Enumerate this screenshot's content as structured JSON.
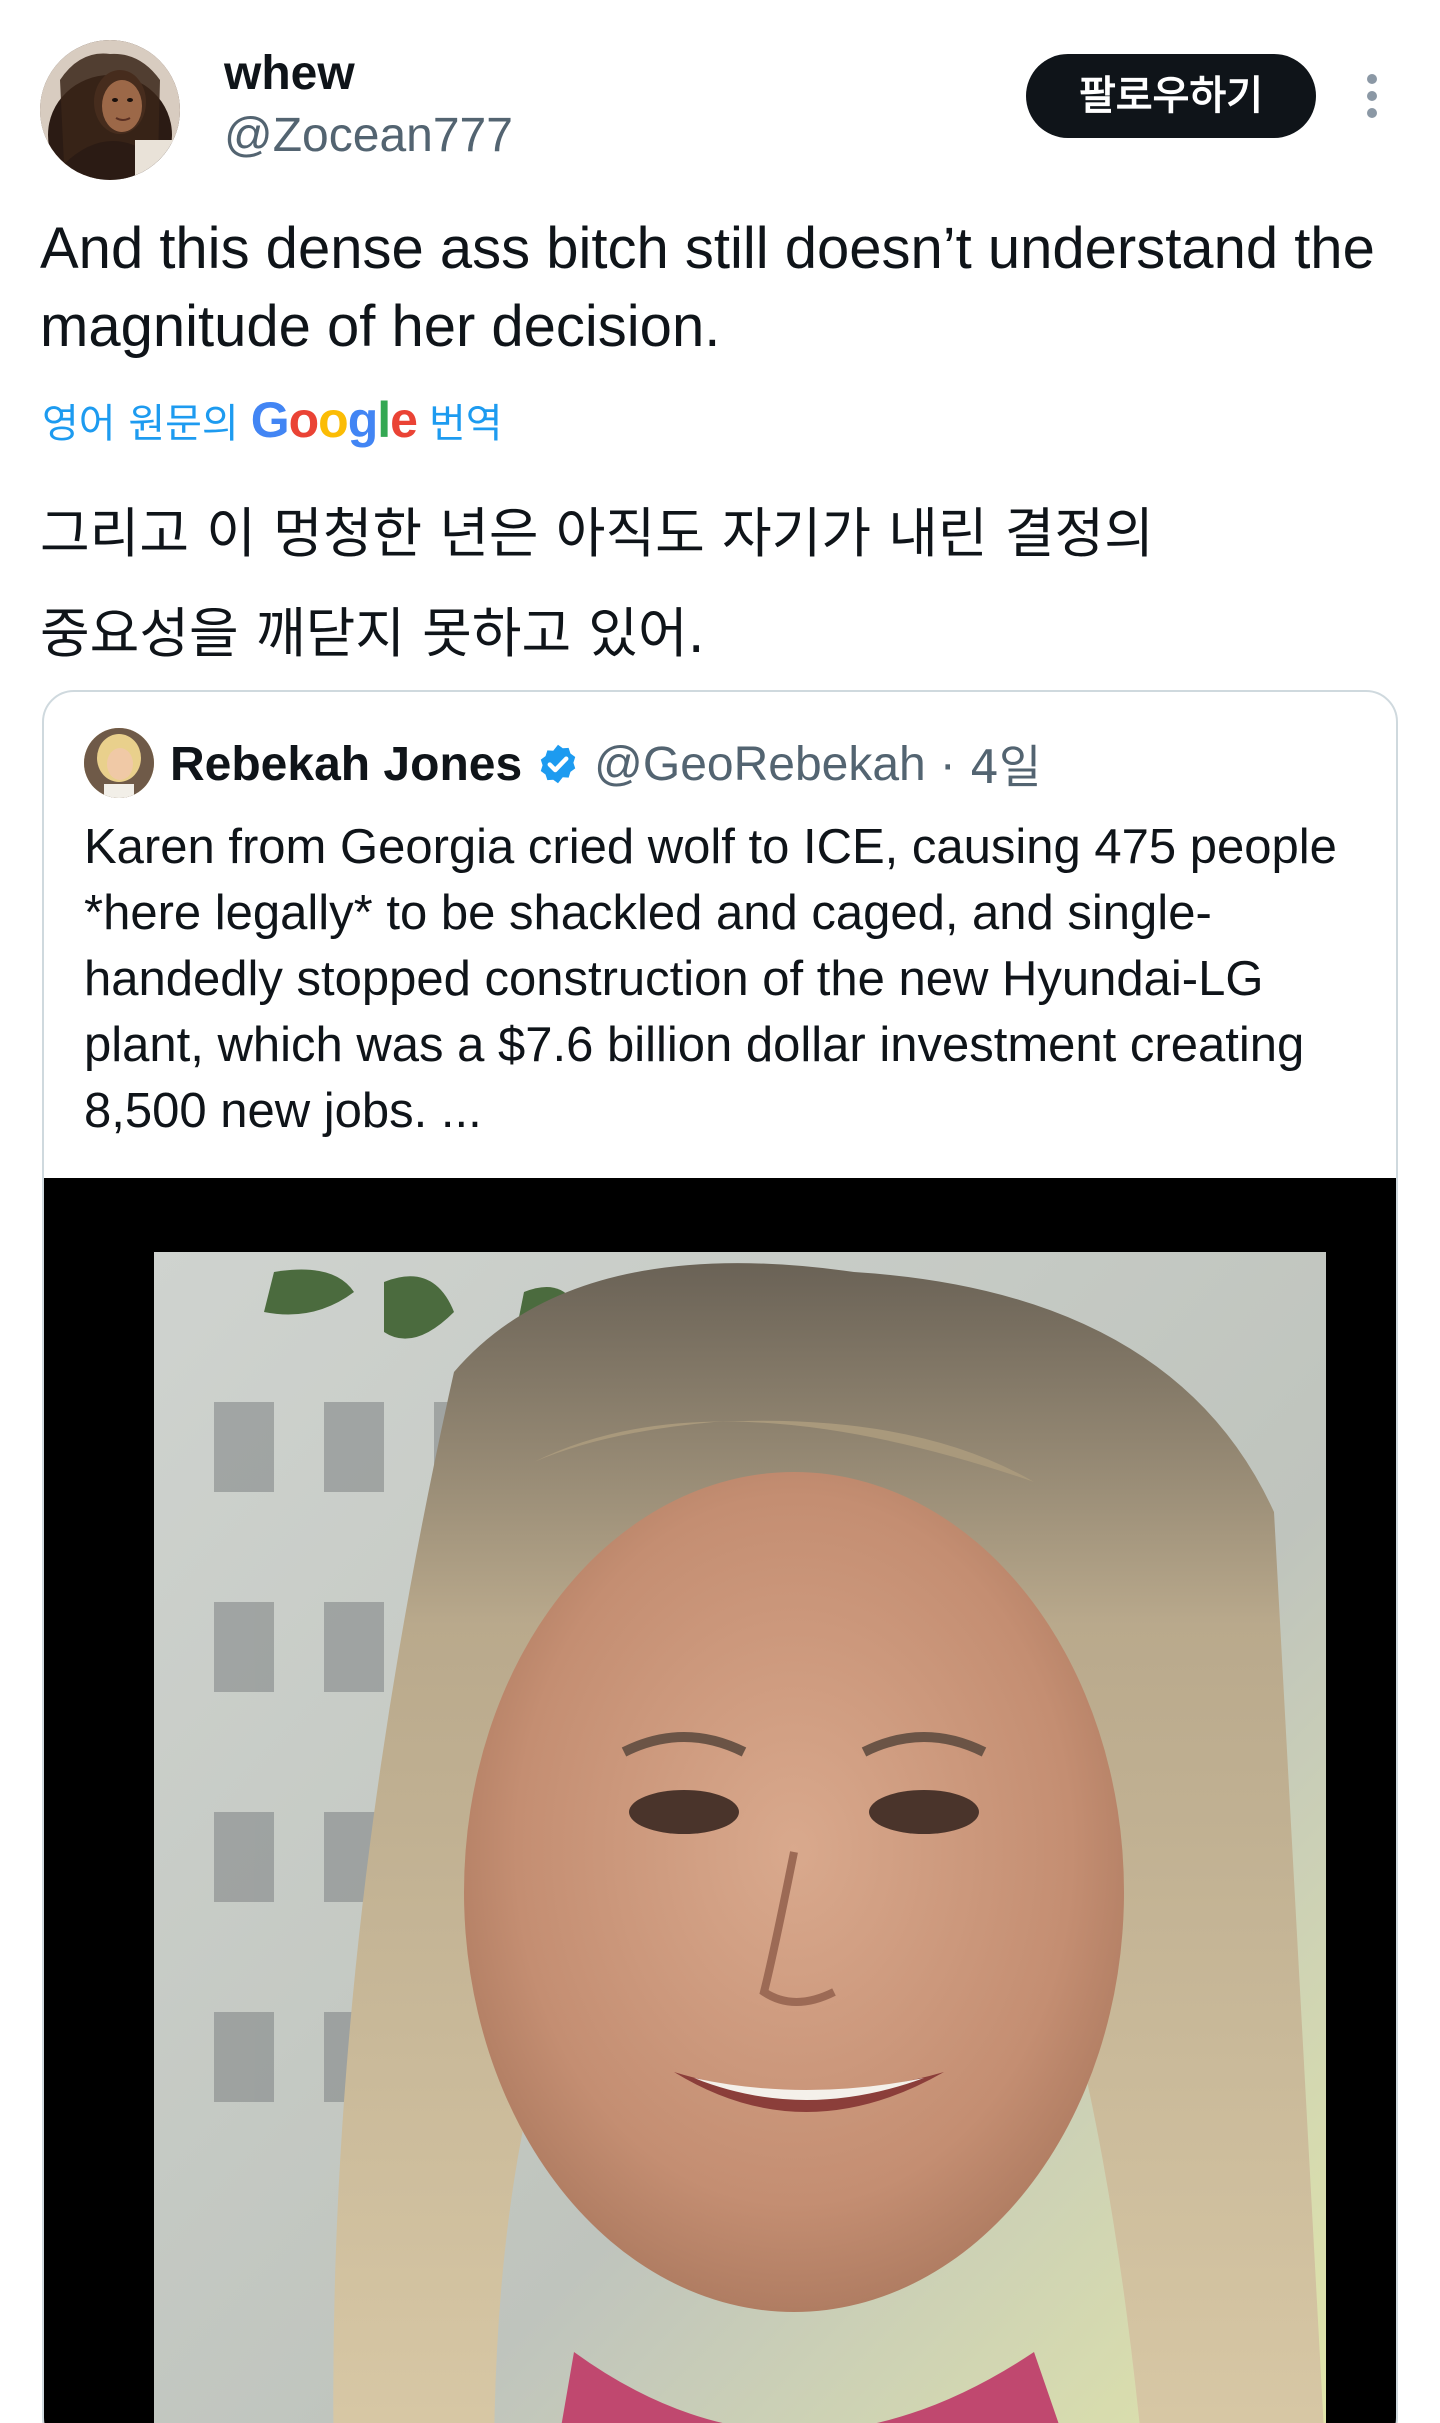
{
  "tweet": {
    "author": {
      "display_name": "whew",
      "handle": "@Zocean777"
    },
    "follow_label": "팔로우하기",
    "text": "And this dense ass bitch still doesn’t understand the magnitude of her decision.",
    "translate": {
      "prefix": "영어 원문의",
      "logo_letters": [
        "G",
        "o",
        "o",
        "g",
        "l",
        "e"
      ],
      "suffix": "번역"
    },
    "translated_lines": [
      "그리고 이 멍청한 년은 아직도 자기가 내린 결정의",
      "중요성을 깨닫지 못하고 있어."
    ]
  },
  "quote": {
    "display_name": "Rebekah Jones",
    "handle": "@GeoRebekah",
    "separator": "·",
    "time": "4일",
    "text": "Karen from Georgia cried wolf to ICE, causing 475 people *here legally* to be shackled and caged, and single-handedly stopped construction of the new Hyundai-LG plant, which was a $7.6 billion dollar investment creating 8,500 new jobs. ..."
  },
  "colors": {
    "follow_bg": "#0f1419",
    "link_blue": "#1d9bf0",
    "secondary_text": "#536471",
    "card_border": "#cfd9de"
  },
  "icons": {
    "verified": "verified-badge-icon",
    "more": "more-vertical-icon"
  }
}
